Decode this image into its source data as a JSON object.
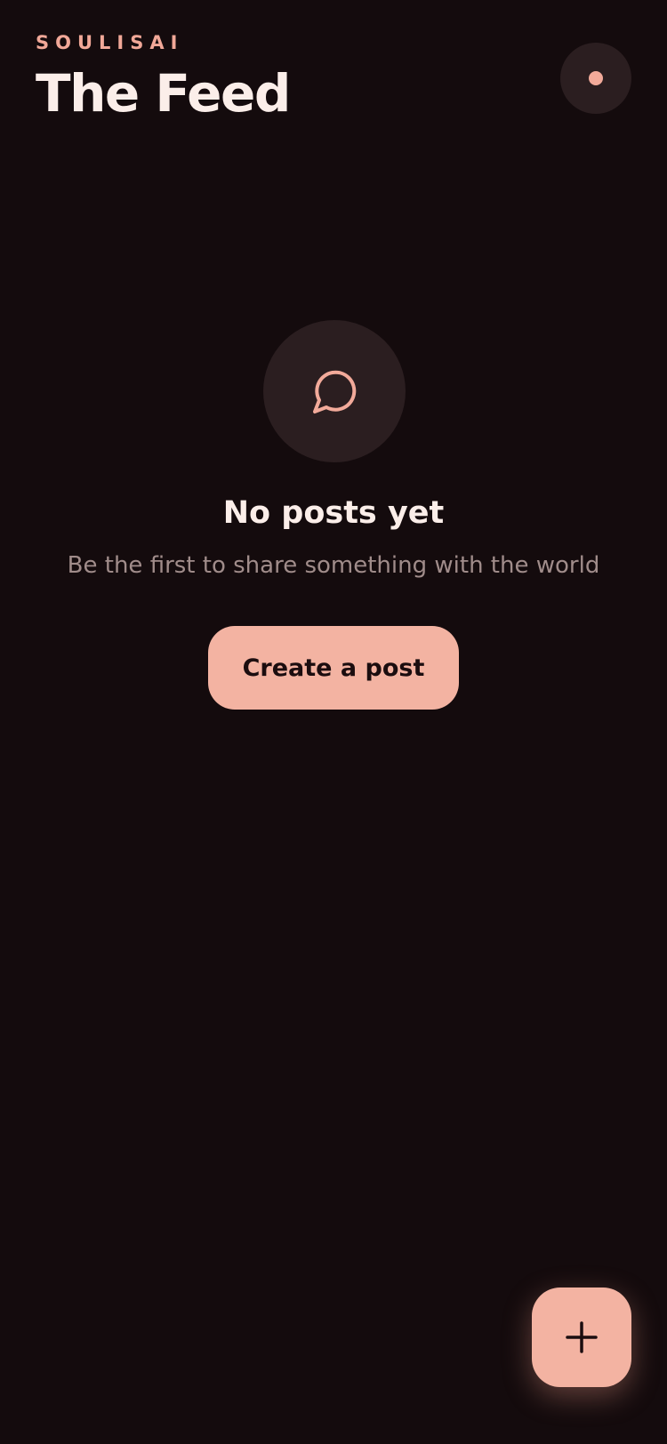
{
  "header": {
    "brand": "SOULISAI",
    "title": "The Feed"
  },
  "profile": {
    "icon": "status-dot-icon"
  },
  "empty_state": {
    "icon": "chat-bubble-icon",
    "title": "No posts yet",
    "subtitle": "Be the first to share something with the world",
    "cta_label": "Create a post"
  },
  "fab": {
    "icon": "plus-icon"
  },
  "colors": {
    "background": "#140b0d",
    "accent": "#f3b3a2",
    "surface": "#2b1e20",
    "text_primary": "#fbeee9",
    "text_secondary": "#a08c8a"
  }
}
